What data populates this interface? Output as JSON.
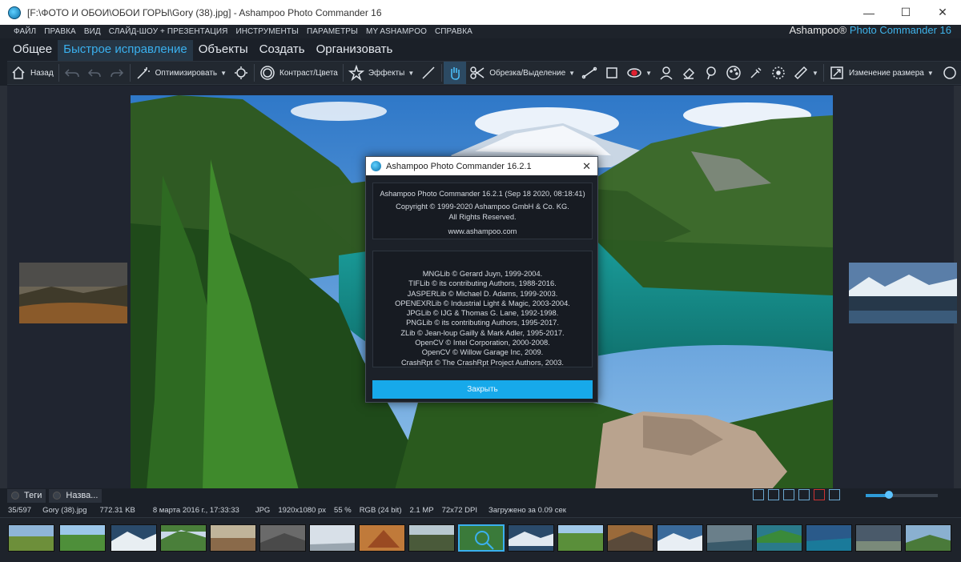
{
  "window": {
    "title": "[F:\\ФОТО И ОБОИ\\ОБОИ ГОРЫ\\Gory (38).jpg] - Ashampoo Photo Commander 16",
    "minimize": "—",
    "maximize": "☐",
    "close": "✕"
  },
  "menu": [
    "ФАЙЛ",
    "ПРАВКА",
    "ВИД",
    "СЛАЙД-ШОУ + ПРЕЗЕНТАЦИЯ",
    "ИНСТРУМЕНТЫ",
    "ПАРАМЕТРЫ",
    "MY ASHAMPOO",
    "СПРАВКА"
  ],
  "brand": {
    "part1": "Ashampoo® ",
    "part2": "Photo Commander 16"
  },
  "tabs": [
    {
      "label": "Общее"
    },
    {
      "label": "Быстрое исправление",
      "active": true
    },
    {
      "label": "Объекты"
    },
    {
      "label": "Создать"
    },
    {
      "label": "Организовать"
    }
  ],
  "toolbar": {
    "back": "Назад",
    "optimize": "Оптимизировать",
    "contrast": "Контраст/Цвета",
    "effects": "Эффекты",
    "crop": "Обрезка/Выделение",
    "resize": "Изменение размера"
  },
  "dialog": {
    "title": "Ashampoo Photo Commander 16.2.1",
    "about_lines": [
      "Ashampoo Photo Commander 16.2.1 (Sep 18 2020, 08:18:41)",
      "Copyright © 1999-2020 Ashampoo GmbH & Co. KG.",
      "All Rights Reserved.",
      "",
      "www.ashampoo.com"
    ],
    "credits": [
      "MNGLib © Gerard Juyn, 1999-2004.",
      "TIFLib © its contributing Authors, 1988-2016.",
      "JASPERLib © Michael D. Adams, 1999-2003.",
      "OPENEXRLib © Industrial Light & Magic, 2003-2004.",
      "JPGLib © IJG & Thomas G. Lane, 1992-1998.",
      "PNGLib © its contributing Authors, 1995-2017.",
      "ZLib © Jean-loup Gailly & Mark Adler, 1995-2017.",
      "OpenCV © Intel Corporation, 2000-2008.",
      "OpenCV © Willow Garage Inc, 2009.",
      "CrashRpt © The CrashRpt Project Authors, 2003."
    ],
    "close_button": "Закрыть",
    "close_icon": "close-icon"
  },
  "bottom_tabs": [
    "Теги",
    "Назва..."
  ],
  "status": {
    "index": "35/597",
    "filename": "Gory (38).jpg",
    "filesize": "772.31 KB",
    "date": "8 марта 2016 г., 17:33:33",
    "format": "JPG",
    "resolution": "1920x1080 px",
    "zoom": "55 %",
    "color": "RGB (24 bit)",
    "megapixels": "2.1 MP",
    "dpi": "72x72 DPI",
    "load_time": "Загружено за 0.09 сек"
  },
  "zoom_slider_fraction": 0.32,
  "colors": {
    "accent": "#3ab0ee",
    "button": "#17a9ea",
    "background": "#1b2028"
  }
}
